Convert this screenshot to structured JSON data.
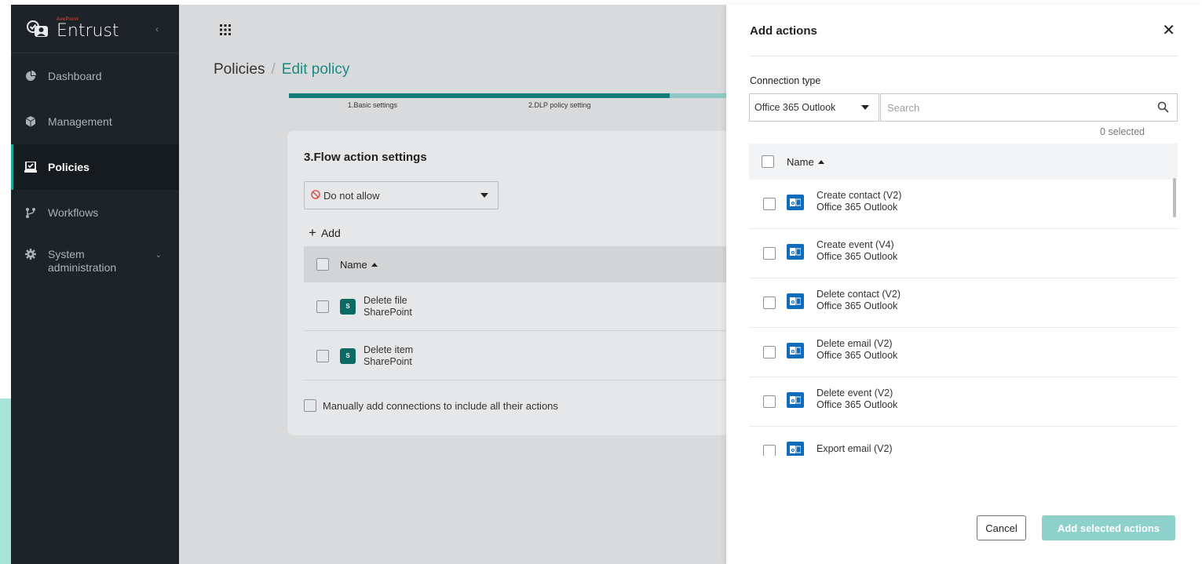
{
  "brand": {
    "company": "AvePoint",
    "product": "Entrust",
    "collapse_icon": "chevron-left-icon"
  },
  "sidebar": {
    "items": [
      {
        "label": "Dashboard",
        "icon": "pie-chart-icon",
        "active": false
      },
      {
        "label": "Management",
        "icon": "cube-icon",
        "active": false
      },
      {
        "label": "Policies",
        "icon": "policy-icon",
        "active": true
      },
      {
        "label": "Workflows",
        "icon": "workflow-icon",
        "active": false
      },
      {
        "label_line1": "System",
        "label_line2": "administration",
        "icon": "gear-icon",
        "active": false,
        "expandable": true
      }
    ]
  },
  "breadcrumb": {
    "root": "Policies",
    "separator": "/",
    "current": "Edit policy"
  },
  "stepper": {
    "progress": 0.87,
    "steps": [
      "1.Basic settings",
      "2.DLP policy setting"
    ]
  },
  "flow_card": {
    "title": "3.Flow action settings",
    "permission_select": "Do not allow",
    "add_label": "Add",
    "column_name": "Name",
    "rows": [
      {
        "name": "Delete file",
        "connector": "SharePoint"
      },
      {
        "name": "Delete item",
        "connector": "SharePoint"
      }
    ],
    "manual_checkbox_label": "Manually add connections to include all their actions"
  },
  "panel": {
    "title": "Add actions",
    "connection_type_label": "Connection type",
    "connection_type_value": "Office 365 Outlook",
    "search_placeholder": "Search",
    "selected_count": "0 selected",
    "column_name": "Name",
    "rows": [
      {
        "name": "Create contact (V2)",
        "connector": "Office 365 Outlook"
      },
      {
        "name": "Create event (V4)",
        "connector": "Office 365 Outlook"
      },
      {
        "name": "Delete contact (V2)",
        "connector": "Office 365 Outlook"
      },
      {
        "name": "Delete email (V2)",
        "connector": "Office 365 Outlook"
      },
      {
        "name": "Delete event (V2)",
        "connector": "Office 365 Outlook"
      },
      {
        "name": "Export email (V2)",
        "connector": ""
      }
    ],
    "cancel_label": "Cancel",
    "add_label": "Add selected actions"
  },
  "colors": {
    "sidebar_bg": "#1d2329",
    "accent_teal": "#127d76",
    "outlook_blue": "#0f6cbd",
    "sharepoint_teal": "#0b6a64",
    "primary_disabled": "#8ed1cb"
  }
}
